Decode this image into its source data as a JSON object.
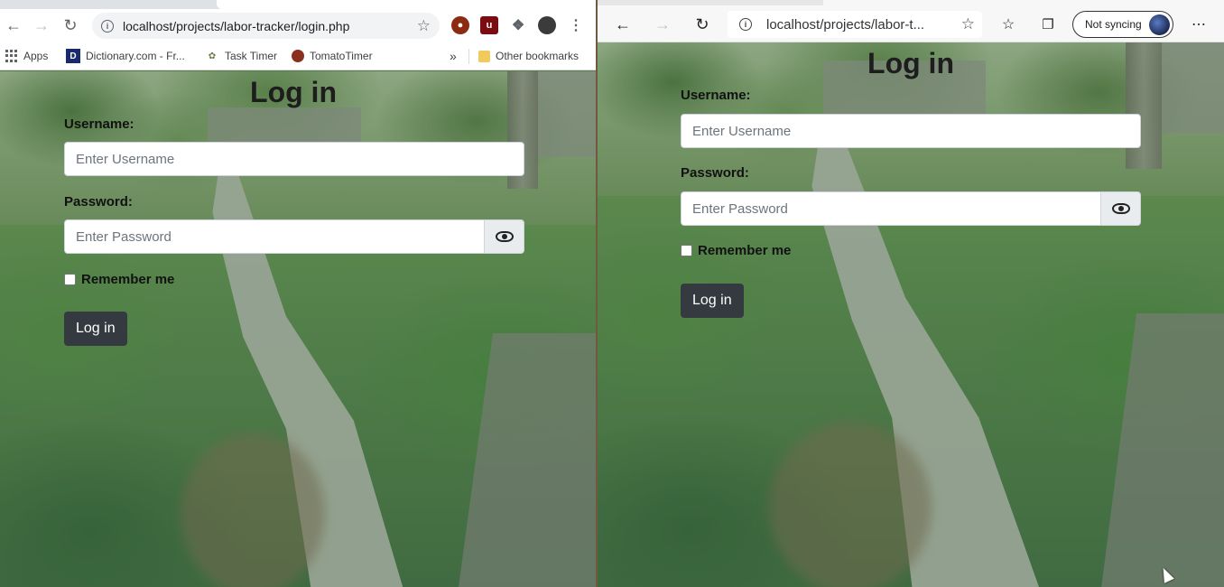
{
  "left_browser": {
    "url": "localhost/projects/labor-tracker/login.php",
    "bookmarks": [
      {
        "label": "Apps",
        "icon": "apps-grid-icon"
      },
      {
        "label": "Dictionary.com - Fr...",
        "icon": "dictionary-icon"
      },
      {
        "label": "Task Timer",
        "icon": "task-timer-icon"
      },
      {
        "label": "TomatoTimer",
        "icon": "tomato-icon"
      }
    ],
    "bookmarks_overflow": "»",
    "other_bookmarks": "Other bookmarks"
  },
  "right_browser": {
    "url": "localhost/projects/labor-t...",
    "sync_label": "Not syncing"
  },
  "login_form": {
    "title": "Log in",
    "username_label": "Username:",
    "username_placeholder": "Enter Username",
    "password_label": "Password:",
    "password_placeholder": "Enter Password",
    "remember_label": "Remember me",
    "submit_label": "Log in"
  },
  "colors": {
    "button_bg": "#343a40",
    "input_addon_bg": "#e9ecef"
  }
}
